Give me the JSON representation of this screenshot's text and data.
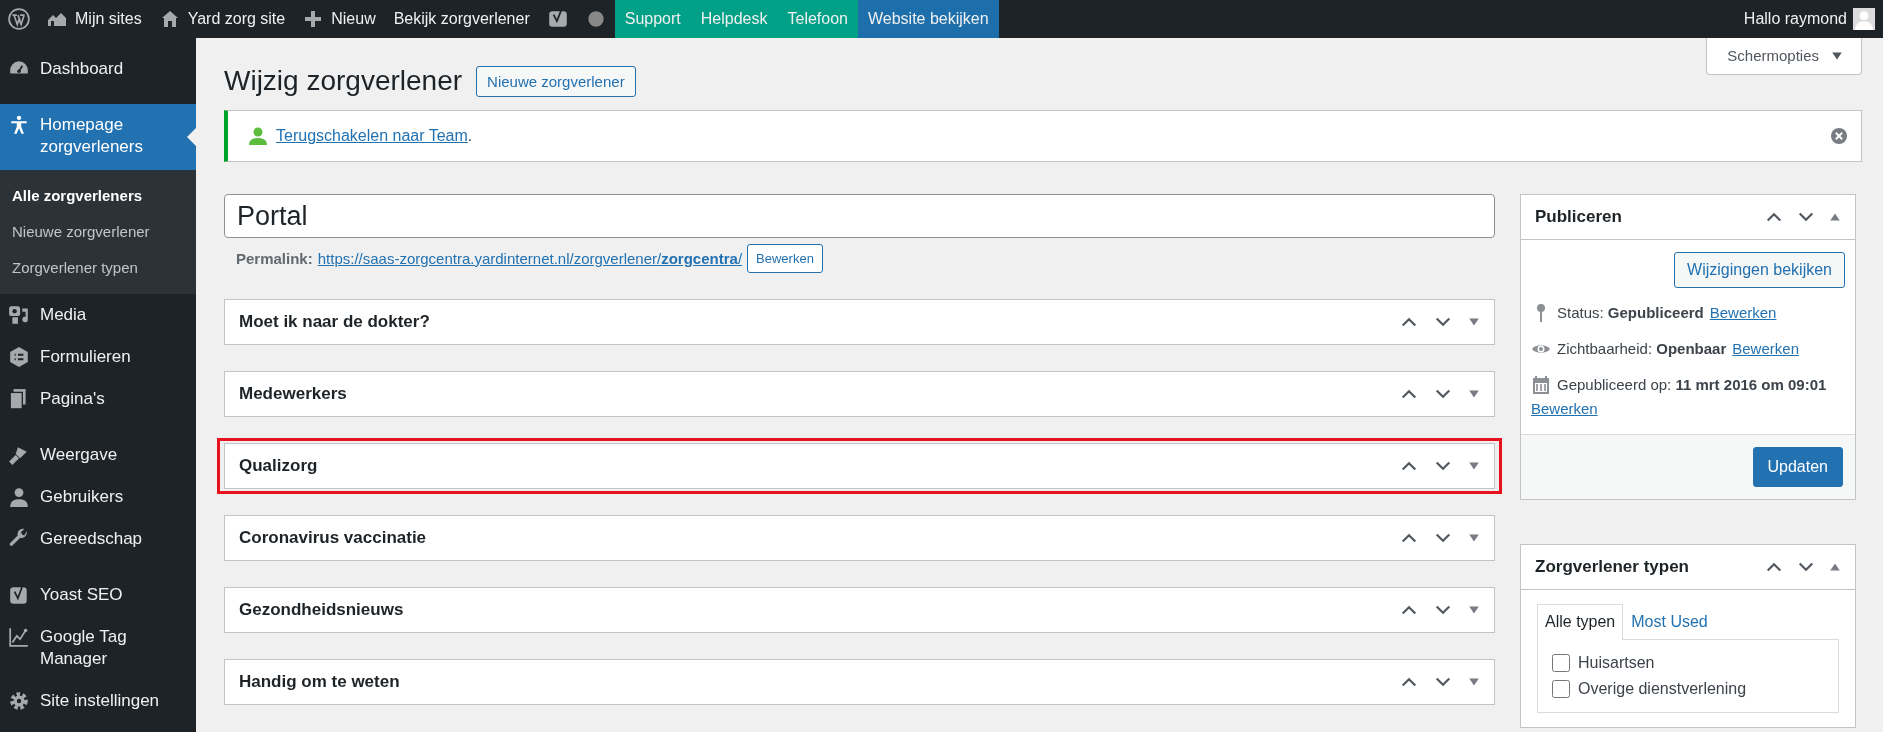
{
  "admin_bar": {
    "items": [
      {
        "kind": "wp-logo"
      },
      {
        "kind": "sites",
        "label": "Mijn sites"
      },
      {
        "kind": "home",
        "label": "Yard zorg site"
      },
      {
        "kind": "new",
        "label": "Nieuw"
      },
      {
        "kind": "text",
        "label": "Bekijk zorgverlener"
      },
      {
        "kind": "yoast"
      },
      {
        "kind": "dot"
      },
      {
        "kind": "colored",
        "label": "Support",
        "color": "#00a186"
      },
      {
        "kind": "colored",
        "label": "Helpdesk",
        "color": "#00a186"
      },
      {
        "kind": "colored",
        "label": "Telefoon",
        "color": "#00a186"
      },
      {
        "kind": "colored",
        "label": "Website bekijken",
        "color": "#1d6fab"
      }
    ],
    "account": "Hallo raymond"
  },
  "sidebar": {
    "items": [
      {
        "kind": "item",
        "label": "Dashboard",
        "selected": false
      },
      {
        "kind": "separator"
      },
      {
        "kind": "item",
        "label": "Homepage zorgverleners",
        "selected": true,
        "children": [
          {
            "label": "Alle zorgverleners",
            "selected": true
          },
          {
            "label": "Nieuwe zorgverlener",
            "selected": false
          },
          {
            "label": "Zorgverlener typen",
            "selected": false
          }
        ]
      },
      {
        "kind": "item",
        "label": "Media",
        "selected": false
      },
      {
        "kind": "item",
        "label": "Formulieren",
        "selected": false
      },
      {
        "kind": "item",
        "label": "Pagina's",
        "selected": false
      },
      {
        "kind": "separator"
      },
      {
        "kind": "item",
        "label": "Weergave",
        "selected": false
      },
      {
        "kind": "item",
        "label": "Gebruikers",
        "selected": false
      },
      {
        "kind": "item",
        "label": "Gereedschap",
        "selected": false
      },
      {
        "kind": "separator"
      },
      {
        "kind": "item",
        "label": "Yoast SEO",
        "selected": false
      },
      {
        "kind": "item",
        "label": "Google Tag Manager",
        "selected": false
      },
      {
        "kind": "item",
        "label": "Site instellingen",
        "selected": false
      }
    ]
  },
  "screen_options": "Schermopties",
  "page_title": "Wijzig zorgverlener",
  "add_new_button": "Nieuwe zorgverlener",
  "notice": {
    "link": "Terugschakelen naar Team",
    "suffix": "."
  },
  "title_field": {
    "value": "Portal"
  },
  "permalink": {
    "label": "Permalink:",
    "url": "https://saas-zorgcentra.yardinternet.nl/zorgverlener/**zorgcentra**/",
    "edit_button": "Bewerken"
  },
  "metaboxes": [
    {
      "title": "Moet ik naar de dokter?",
      "highlighted": false
    },
    {
      "title": "Medewerkers",
      "highlighted": false
    },
    {
      "title": "Qualizorg",
      "highlighted": true
    },
    {
      "title": "Coronavirus vaccinatie",
      "highlighted": false
    },
    {
      "title": "Gezondheidsnieuws",
      "highlighted": false
    },
    {
      "title": "Handig om te weten",
      "highlighted": false
    }
  ],
  "publish": {
    "title": "Publiceren",
    "preview_button": "Wijzigingen bekijken",
    "rows": [
      {
        "label": "Status:",
        "value": "Gepubliceerd",
        "link": "Bewerken"
      },
      {
        "label": "Zichtbaarheid:",
        "value": "Openbaar",
        "link": "Bewerken"
      },
      {
        "label": "Gepubliceerd op:",
        "value": "11 mrt 2016 om 09:01",
        "link": "Bewerken"
      }
    ],
    "update_button": "Updaten"
  },
  "taxonomy": {
    "title": "Zorgverlener typen",
    "tabs": [
      {
        "label": "Alle typen",
        "selected": true
      },
      {
        "label": "Most Used",
        "selected": false
      }
    ],
    "terms": [
      {
        "label": "Huisartsen",
        "checked": false
      },
      {
        "label": "Overige dienstverlening",
        "checked": false
      }
    ]
  }
}
